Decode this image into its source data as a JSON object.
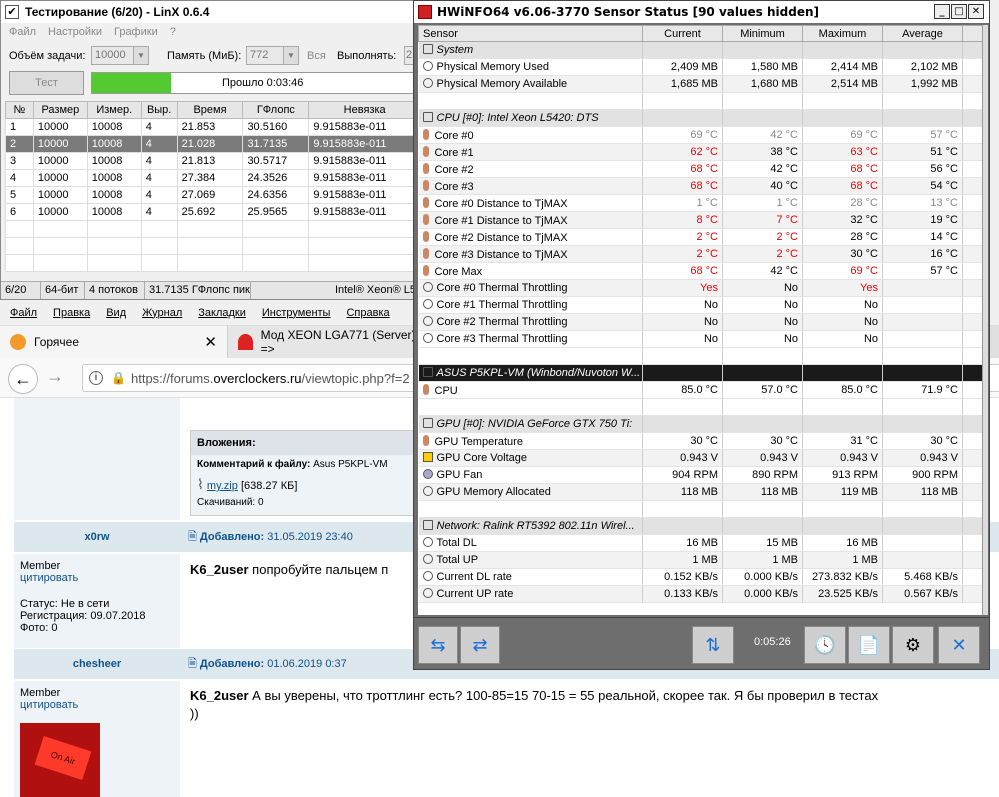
{
  "linx": {
    "title": "Тестирование (6/20) - LinX 0.6.4",
    "menu": [
      "Файл",
      "Настройки",
      "Графики",
      "?"
    ],
    "params": {
      "size_label": "Объём задачи:",
      "size_value": "10000",
      "mem_label": "Память (МиБ):",
      "mem_value": "772",
      "all_label": "Вся",
      "run_label": "Выполнять:",
      "run_value": "2"
    },
    "test_button": "Тест",
    "progress_text": "Прошло 0:03:46",
    "progress_fraction": 0.24,
    "columns": [
      "№",
      "Размер",
      "Измер.",
      "Выр.",
      "Время",
      "ГФлопс",
      "Невязка"
    ],
    "rows": [
      [
        "1",
        "10000",
        "10008",
        "4",
        "21.853",
        "30.5160",
        "9.915883e-011"
      ],
      [
        "2",
        "10000",
        "10008",
        "4",
        "21.028",
        "31.7135",
        "9.915883e-011"
      ],
      [
        "3",
        "10000",
        "10008",
        "4",
        "21.813",
        "30.5717",
        "9.915883e-011"
      ],
      [
        "4",
        "10000",
        "10008",
        "4",
        "27.384",
        "24.3526",
        "9.915883e-011"
      ],
      [
        "5",
        "10000",
        "10008",
        "4",
        "27.069",
        "24.6356",
        "9.915883e-011"
      ],
      [
        "6",
        "10000",
        "10008",
        "4",
        "25.692",
        "25.9565",
        "9.915883e-011"
      ]
    ],
    "status": [
      "6/20",
      "64-бит",
      "4 потоков",
      "31.7135 ГФлопс пик",
      "Intel® Xeon® L5"
    ]
  },
  "browser": {
    "menu": [
      "Файл",
      "Правка",
      "Вид",
      "Журнал",
      "Закладки",
      "Инструменты",
      "Справка"
    ],
    "tab1": "Горячее",
    "tab2": "Мод XEON LGA771 (Server) =>",
    "url_prefix": "https://forums.",
    "url_domain": "overclockers.ru",
    "url_suffix": "/viewtopic.php?f=2",
    "attachments_title": "Вложения:",
    "attach_comment_label": "Комментарий к файлу:",
    "attach_comment": "Asus P5KPL-VM",
    "attach_file": "my.zip",
    "attach_size": "[638.27 КБ]",
    "attach_downloads": "Скачиваний: 0",
    "post1": {
      "author": "x0rw",
      "added": "Добавлено:",
      "date": "31.05.2019 23:40",
      "rank": "Member",
      "quote": "цитировать",
      "status": "Статус: Не в сети",
      "reg": "Регистрация: 09.07.2018",
      "photo": "Фото: 0",
      "mention": "K6_2user",
      "text": "попробуйте пальцем п"
    },
    "post2": {
      "author": "chesheer",
      "added": "Добавлено:",
      "date": "01.06.2019 0:37",
      "rank": "Member",
      "quote": "цитировать",
      "mention": "K6_2user",
      "text": "А вы уверены, что троттлинг есть? 100-85=15 70-15 = 55 реальной, скорее так. Я бы проверил в тестах",
      "text2": "))",
      "avatar_text": "On Air"
    }
  },
  "hwinfo": {
    "title": "HWiNFO64 v6.06-3770 Sensor Status [90 values hidden]",
    "columns": [
      "Sensor",
      "Current",
      "Minimum",
      "Maximum",
      "Average"
    ],
    "rows": [
      {
        "type": "group",
        "name": "System"
      },
      {
        "type": "row",
        "icon": "round",
        "name": "Physical Memory Used",
        "v": [
          "2,409 MB",
          "1,580 MB",
          "2,414 MB",
          "2,102 MB"
        ]
      },
      {
        "type": "row",
        "icon": "round",
        "name": "Physical Memory Available",
        "v": [
          "1,685 MB",
          "1,680 MB",
          "2,514 MB",
          "1,992 MB"
        ]
      },
      {
        "type": "space"
      },
      {
        "type": "group",
        "name": "CPU [#0]: Intel Xeon L5420: DTS"
      },
      {
        "type": "row",
        "icon": "therm",
        "name": "Core #0",
        "v": [
          "69 °C",
          "42 °C",
          "69 °C",
          "57 °C"
        ],
        "c": [
          "grey",
          "grey",
          "grey",
          "grey"
        ]
      },
      {
        "type": "row",
        "icon": "therm",
        "name": "Core #1",
        "v": [
          "62 °C",
          "38 °C",
          "63 °C",
          "51 °C"
        ],
        "c": [
          "red",
          "",
          "red",
          ""
        ]
      },
      {
        "type": "row",
        "icon": "therm",
        "name": "Core #2",
        "v": [
          "68 °C",
          "42 °C",
          "68 °C",
          "56 °C"
        ],
        "c": [
          "red",
          "",
          "red",
          ""
        ]
      },
      {
        "type": "row",
        "icon": "therm",
        "name": "Core #3",
        "v": [
          "68 °C",
          "40 °C",
          "68 °C",
          "54 °C"
        ],
        "c": [
          "red",
          "",
          "red",
          ""
        ]
      },
      {
        "type": "row",
        "icon": "therm",
        "name": "Core #0 Distance to TjMAX",
        "v": [
          "1 °C",
          "1 °C",
          "28 °C",
          "13 °C"
        ],
        "c": [
          "grey",
          "grey",
          "grey",
          "grey"
        ]
      },
      {
        "type": "row",
        "icon": "therm",
        "name": "Core #1 Distance to TjMAX",
        "v": [
          "8 °C",
          "7 °C",
          "32 °C",
          "19 °C"
        ],
        "c": [
          "red",
          "red",
          "",
          ""
        ]
      },
      {
        "type": "row",
        "icon": "therm",
        "name": "Core #2 Distance to TjMAX",
        "v": [
          "2 °C",
          "2 °C",
          "28 °C",
          "14 °C"
        ],
        "c": [
          "red",
          "red",
          "",
          ""
        ]
      },
      {
        "type": "row",
        "icon": "therm",
        "name": "Core #3 Distance to TjMAX",
        "v": [
          "2 °C",
          "2 °C",
          "30 °C",
          "16 °C"
        ],
        "c": [
          "red",
          "red",
          "",
          ""
        ]
      },
      {
        "type": "row",
        "icon": "therm",
        "name": "Core Max",
        "v": [
          "68 °C",
          "42 °C",
          "69 °C",
          "57 °C"
        ],
        "c": [
          "red",
          "",
          "red",
          ""
        ]
      },
      {
        "type": "row",
        "icon": "round",
        "name": "Core #0 Thermal Throttling",
        "v": [
          "Yes",
          "No",
          "Yes",
          ""
        ],
        "c": [
          "red",
          "",
          "red",
          ""
        ]
      },
      {
        "type": "row",
        "icon": "round",
        "name": "Core #1 Thermal Throttling",
        "v": [
          "No",
          "No",
          "No",
          ""
        ]
      },
      {
        "type": "row",
        "icon": "round",
        "name": "Core #2 Thermal Throttling",
        "v": [
          "No",
          "No",
          "No",
          ""
        ]
      },
      {
        "type": "row",
        "icon": "round",
        "name": "Core #3 Thermal Throttling",
        "v": [
          "No",
          "No",
          "No",
          ""
        ]
      },
      {
        "type": "space"
      },
      {
        "type": "group",
        "dark": true,
        "name": "ASUS P5KPL-VM (Winbond/Nuvoton W..."
      },
      {
        "type": "row",
        "icon": "therm",
        "name": "CPU",
        "v": [
          "85.0 °C",
          "57.0 °C",
          "85.0 °C",
          "71.9 °C"
        ]
      },
      {
        "type": "space"
      },
      {
        "type": "group",
        "name": "GPU [#0]: NVIDIA GeForce GTX 750 Ti:"
      },
      {
        "type": "row",
        "icon": "therm",
        "name": "GPU Temperature",
        "v": [
          "30 °C",
          "30 °C",
          "31 °C",
          "30 °C"
        ]
      },
      {
        "type": "row",
        "icon": "bolt",
        "name": "GPU Core Voltage",
        "v": [
          "0.943 V",
          "0.943 V",
          "0.943 V",
          "0.943 V"
        ]
      },
      {
        "type": "row",
        "icon": "fan",
        "name": "GPU Fan",
        "v": [
          "904 RPM",
          "890 RPM",
          "913 RPM",
          "900 RPM"
        ]
      },
      {
        "type": "row",
        "icon": "round",
        "name": "GPU Memory Allocated",
        "v": [
          "118 MB",
          "118 MB",
          "119 MB",
          "118 MB"
        ]
      },
      {
        "type": "space"
      },
      {
        "type": "group",
        "name": "Network: Ralink RT5392 802.11n Wirel..."
      },
      {
        "type": "row",
        "icon": "round",
        "name": "Total DL",
        "v": [
          "16 MB",
          "15 MB",
          "16 MB",
          ""
        ]
      },
      {
        "type": "row",
        "icon": "round",
        "name": "Total UP",
        "v": [
          "1 MB",
          "1 MB",
          "1 MB",
          ""
        ]
      },
      {
        "type": "row",
        "icon": "round",
        "name": "Current DL rate",
        "v": [
          "0.152 KB/s",
          "0.000 KB/s",
          "273.832 KB/s",
          "5.468 KB/s"
        ]
      },
      {
        "type": "row",
        "icon": "round",
        "name": "Current UP rate",
        "v": [
          "0.133 KB/s",
          "0.000 KB/s",
          "23.525 KB/s",
          "0.567 KB/s"
        ]
      }
    ],
    "timer": "0:05:26"
  }
}
